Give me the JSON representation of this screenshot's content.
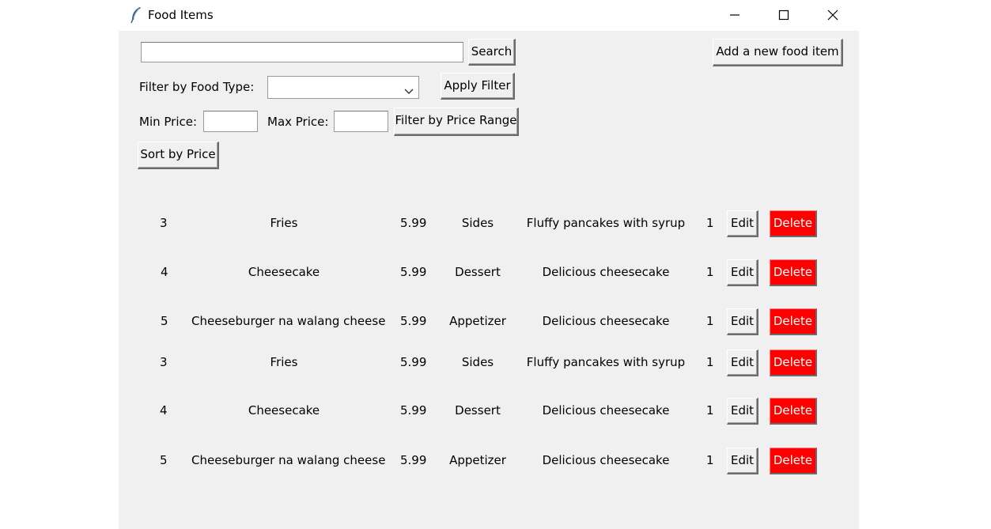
{
  "window": {
    "title": "Food Items",
    "controls": [
      "minimize-icon",
      "maximize-icon",
      "close-icon"
    ]
  },
  "toolbar": {
    "search_value": "",
    "search_label": "Search",
    "add_label": "Add a new food item",
    "filter_type_label": "Filter by Food Type:",
    "filter_type_value": "",
    "apply_filter_label": "Apply Filter",
    "min_price_label": "Min Price:",
    "min_price_value": "",
    "max_price_label": "Max Price:",
    "max_price_value": "",
    "filter_price_label": "Filter by Price Range",
    "sort_label": "Sort by Price"
  },
  "items": [
    {
      "id": "3",
      "name": "Fries",
      "price": "5.99",
      "type": "Sides",
      "description": "Fluffy pancakes with syrup",
      "qty": "1",
      "edit": "Edit",
      "delete": "Delete"
    },
    {
      "id": "4",
      "name": "Cheesecake",
      "price": "5.99",
      "type": "Dessert",
      "description": "Delicious cheesecake",
      "qty": "1",
      "edit": "Edit",
      "delete": "Delete"
    },
    {
      "id": "5",
      "name": "Cheeseburger na walang cheese",
      "price": "5.99",
      "type": "Appetizer",
      "description": "Delicious cheesecake",
      "qty": "1",
      "edit": "Edit",
      "delete": "Delete"
    },
    {
      "id": "3",
      "name": "Fries",
      "price": "5.99",
      "type": "Sides",
      "description": "Fluffy pancakes with syrup",
      "qty": "1",
      "edit": "Edit",
      "delete": "Delete"
    },
    {
      "id": "4",
      "name": "Cheesecake",
      "price": "5.99",
      "type": "Dessert",
      "description": "Delicious cheesecake",
      "qty": "1",
      "edit": "Edit",
      "delete": "Delete"
    },
    {
      "id": "5",
      "name": "Cheeseburger na walang cheese",
      "price": "5.99",
      "type": "Appetizer",
      "description": "Delicious cheesecake",
      "qty": "1",
      "edit": "Edit",
      "delete": "Delete"
    }
  ],
  "colors": {
    "window_bg": "#f0f0f0",
    "delete_bg": "#ff0000",
    "delete_text": "#ffffff"
  }
}
